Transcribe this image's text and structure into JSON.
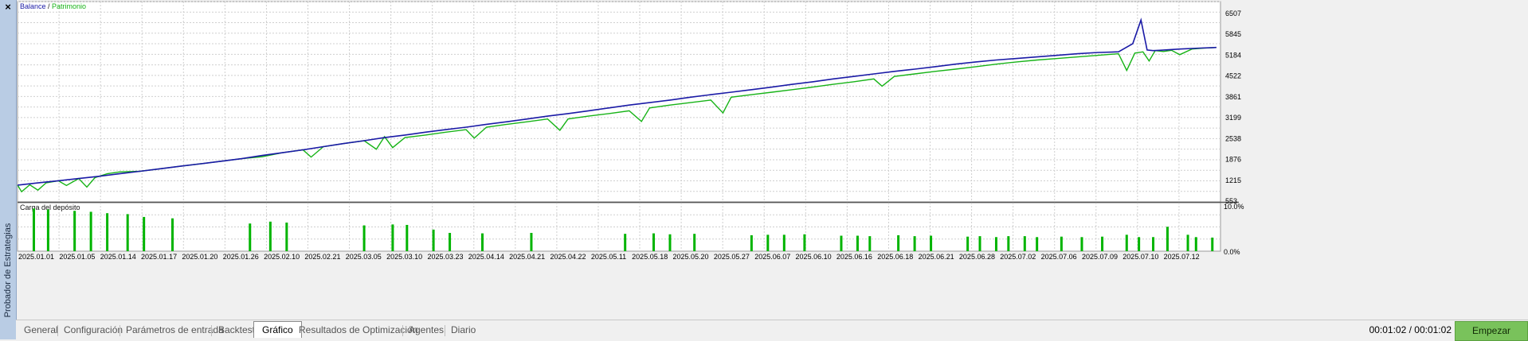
{
  "window": {
    "close_glyph": "×",
    "side_title": "Probador de Estrategias"
  },
  "chart_data": [
    {
      "type": "line",
      "title": "",
      "legend": [
        "Balance",
        "Patrimonio"
      ],
      "legend_separator": "/",
      "legend_placement": "top-left",
      "colors": {
        "balance": "#1a1aa6",
        "equity": "#17b317",
        "grid": "#cfcfcf",
        "background": "#ffffff"
      },
      "grid": true,
      "ylim": [
        553,
        6507
      ],
      "y_ticks": [
        "6507",
        "5845",
        "5184",
        "4522",
        "3861",
        "3199",
        "2538",
        "1876",
        "1215",
        "553"
      ],
      "x_ticks": [
        "2025.01.01",
        "2025.01.05",
        "2025.01.14",
        "2025.01.17",
        "2025.01.20",
        "2025.01.26",
        "2025.02.10",
        "2025.02.21",
        "2025.03.05",
        "2025.03.10",
        "2025.03.23",
        "2025.04.14",
        "2025.04.21",
        "2025.04.22",
        "2025.05.11",
        "2025.05.18",
        "2025.05.20",
        "2025.05.27",
        "2025.06.07",
        "2025.06.10",
        "2025.06.16",
        "2025.06.18",
        "2025.06.21",
        "2025.06.28",
        "2025.07.02",
        "2025.07.06",
        "2025.07.09",
        "2025.07.10",
        "2025.07.12"
      ],
      "series": [
        {
          "name": "Balance",
          "x": [
            0,
            0.5,
            1.0,
            1.5,
            2.0,
            2.5,
            3.0,
            3.5,
            4.0,
            4.5,
            5.0,
            5.5,
            6.0,
            6.5,
            7.0,
            7.5,
            8.0,
            8.5,
            9.0,
            9.5,
            10.0,
            10.5,
            11.0,
            11.5,
            12.0,
            12.5,
            13.0,
            13.5,
            14.0,
            14.5,
            15.0,
            15.5,
            16.0,
            16.5,
            17.0,
            17.5,
            18.0,
            18.5,
            19.0,
            19.5,
            20.0,
            20.5,
            21.0,
            21.5,
            22.0,
            22.5,
            23.0,
            23.5,
            24.0,
            24.5,
            25.0,
            25.5,
            26.0,
            26.5,
            27.0,
            27.35,
            27.55,
            27.7,
            27.85,
            28.0,
            28.5,
            29.0,
            29.4
          ],
          "values": [
            1060,
            1130,
            1200,
            1270,
            1340,
            1420,
            1500,
            1580,
            1660,
            1740,
            1820,
            1900,
            2000,
            2090,
            2180,
            2280,
            2380,
            2470,
            2570,
            2650,
            2740,
            2820,
            2900,
            2990,
            3070,
            3160,
            3250,
            3330,
            3420,
            3510,
            3600,
            3680,
            3760,
            3850,
            3930,
            4010,
            4090,
            4170,
            4260,
            4340,
            4430,
            4510,
            4590,
            4670,
            4740,
            4820,
            4900,
            4970,
            5030,
            5080,
            5130,
            5180,
            5230,
            5270,
            5290,
            5550,
            6300,
            5350,
            5330,
            5340,
            5380,
            5410,
            5430
          ]
        },
        {
          "name": "Patrimonio",
          "x": [
            0,
            0.1,
            0.3,
            0.5,
            0.7,
            1.0,
            1.2,
            1.5,
            1.7,
            1.9,
            2.2,
            2.5,
            3.0,
            3.5,
            4.0,
            4.5,
            5.0,
            5.5,
            6.0,
            6.5,
            7.0,
            7.2,
            7.5,
            8.0,
            8.5,
            8.8,
            9.0,
            9.2,
            9.5,
            10.0,
            10.5,
            11.0,
            11.2,
            11.5,
            12.0,
            12.5,
            13.0,
            13.3,
            13.5,
            14.0,
            14.5,
            15.0,
            15.3,
            15.5,
            16.0,
            16.5,
            17.0,
            17.3,
            17.5,
            18.0,
            18.5,
            19.0,
            19.5,
            20.0,
            20.5,
            21.0,
            21.2,
            21.5,
            22.0,
            22.5,
            23.0,
            23.5,
            24.0,
            24.5,
            25.0,
            25.5,
            26.0,
            26.5,
            27.0,
            27.2,
            27.4,
            27.6,
            27.75,
            27.9,
            28.1,
            28.3,
            28.5,
            28.8,
            29.1,
            29.4
          ],
          "values": [
            1060,
            850,
            1070,
            900,
            1130,
            1200,
            1050,
            1270,
            1000,
            1300,
            1420,
            1480,
            1500,
            1580,
            1660,
            1740,
            1820,
            1900,
            1960,
            2090,
            2180,
            1950,
            2280,
            2380,
            2470,
            2200,
            2600,
            2250,
            2570,
            2650,
            2740,
            2820,
            2550,
            2900,
            2990,
            3070,
            3160,
            2800,
            3160,
            3250,
            3330,
            3420,
            3080,
            3510,
            3600,
            3680,
            3760,
            3350,
            3850,
            3930,
            4010,
            4090,
            4170,
            4260,
            4340,
            4430,
            4200,
            4510,
            4590,
            4670,
            4740,
            4820,
            4900,
            4970,
            5030,
            5080,
            5130,
            5180,
            5230,
            4700,
            5250,
            5290,
            5000,
            5330,
            5300,
            5340,
            5200,
            5380,
            5410,
            5430
          ]
        }
      ]
    },
    {
      "type": "bar",
      "title": "Carga del depósito",
      "ylim": [
        0,
        10
      ],
      "y_ticks": [
        "10.0%",
        "0.0%"
      ],
      "color": "#00b400",
      "series": [
        {
          "name": "Carga del depósito",
          "x": [
            0.4,
            0.75,
            1.4,
            1.8,
            2.2,
            2.7,
            3.1,
            3.8,
            5.7,
            6.2,
            6.6,
            8.5,
            9.2,
            9.55,
            10.2,
            10.6,
            11.4,
            12.6,
            14.9,
            15.6,
            16.0,
            16.6,
            18.0,
            18.4,
            18.8,
            19.3,
            20.2,
            20.6,
            20.9,
            21.6,
            22.0,
            22.4,
            23.3,
            23.6,
            24.0,
            24.3,
            24.7,
            25.0,
            25.6,
            26.1,
            26.6,
            27.2,
            27.5,
            27.85,
            28.2,
            28.7,
            28.9,
            29.3
          ],
          "values": [
            9.1,
            8.9,
            8.6,
            8.4,
            8.1,
            7.9,
            7.3,
            7.0,
            5.9,
            6.3,
            6.1,
            5.5,
            5.7,
            5.6,
            4.6,
            3.9,
            3.8,
            3.9,
            3.7,
            3.8,
            3.6,
            3.7,
            3.4,
            3.5,
            3.5,
            3.6,
            3.3,
            3.3,
            3.2,
            3.4,
            3.2,
            3.3,
            3.1,
            3.2,
            3.0,
            3.2,
            3.2,
            3.0,
            3.1,
            3.0,
            3.1,
            3.5,
            3.0,
            3.0,
            5.2,
            3.5,
            3.0,
            2.9
          ]
        }
      ]
    }
  ],
  "tabs": [
    "General",
    "Configuración",
    "Parámetros de entrada",
    "Backtest",
    "Gráfico",
    "Resultados de Optimización",
    "Agentes",
    "Diario"
  ],
  "active_tab": "Gráfico",
  "status": {
    "timer": "00:01:02 / 00:01:02",
    "start_button": "Empezar"
  }
}
